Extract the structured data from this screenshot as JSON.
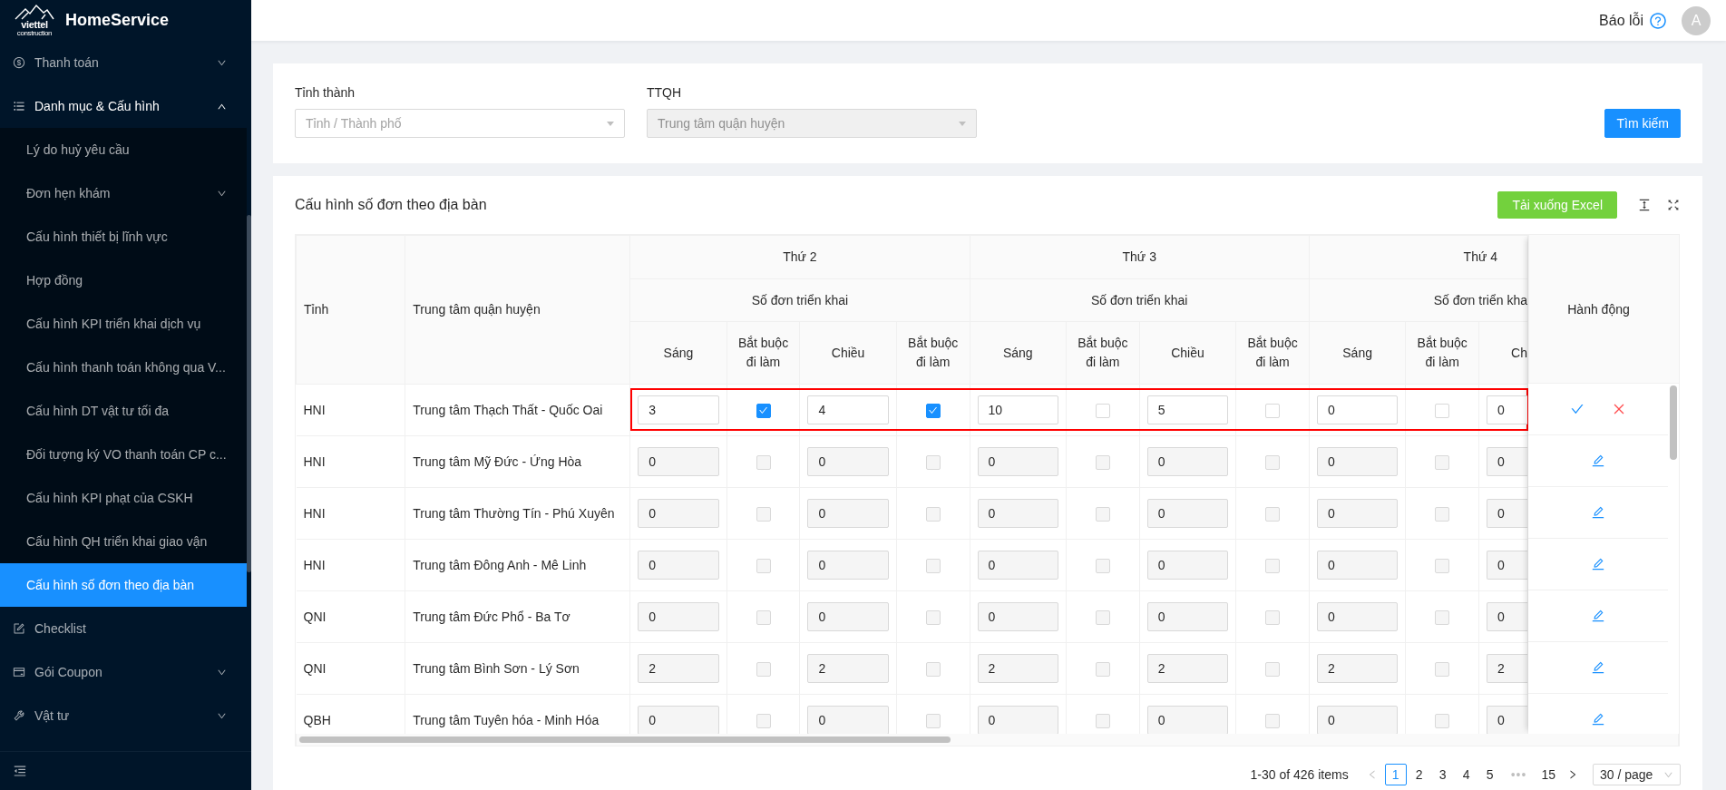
{
  "app": {
    "brand": "HomeService",
    "logo_text": "viettel",
    "logo_subtext": "construction"
  },
  "sidebar": {
    "items": [
      {
        "label": "Thanh toán",
        "kind": "dollar",
        "expanded": false
      },
      {
        "label": "Danh mục & Cấu hình",
        "kind": "list",
        "expanded": true,
        "children": [
          {
            "label": "Lý do huỷ yêu cầu",
            "selected": false
          },
          {
            "label": "Đơn hẹn khám",
            "selected": false,
            "expanded": false
          },
          {
            "label": "Cấu hình thiết bị lĩnh vực",
            "selected": false
          },
          {
            "label": "Hợp đồng",
            "selected": false
          },
          {
            "label": "Cấu hình KPI triển khai dịch vụ",
            "selected": false
          },
          {
            "label": "Cấu hình thanh toán không qua V...",
            "selected": false
          },
          {
            "label": "Cấu hình DT vật tư tối đa",
            "selected": false
          },
          {
            "label": "Đối tượng ký VO thanh toán CP c...",
            "selected": false
          },
          {
            "label": "Cấu hình KPI phạt của CSKH",
            "selected": false
          },
          {
            "label": "Cấu hình QH triển khai giao vận",
            "selected": false
          },
          {
            "label": "Cấu hình số đơn theo địa bàn",
            "selected": true
          }
        ]
      },
      {
        "label": "Checklist",
        "kind": "edit"
      },
      {
        "label": "Gói Coupon",
        "kind": "card",
        "expanded": false
      },
      {
        "label": "Vật tư",
        "kind": "tool",
        "expanded": false
      }
    ]
  },
  "header": {
    "report_label": "Báo lỗi",
    "avatar": "A"
  },
  "filters": {
    "fields": [
      {
        "label": "Tỉnh thành",
        "placeholder": "Tỉnh / Thành phố",
        "disabled": false
      },
      {
        "label": "TTQH",
        "placeholder": "Trung tâm quận huyện",
        "disabled": true
      }
    ],
    "search_button": "Tìm kiếm"
  },
  "table_card": {
    "title": "Cấu hình số đơn theo địa bàn",
    "export_button": "Tải xuống Excel",
    "columns": {
      "province": "Tỉnh",
      "center": "Trung tâm quận huyện",
      "action": "Hành động",
      "days": [
        {
          "label": "Thứ 2",
          "group": "Số đơn triển khai",
          "cut": false,
          "columns": [
            "Sáng",
            "Bắt buộc đi làm",
            "Chiều",
            "Bắt buộc đi làm"
          ]
        },
        {
          "label": "Thứ 3",
          "group": "Số đơn triển khai",
          "cut": false,
          "columns": [
            "Sáng",
            "Bắt buộc đi làm",
            "Chiều",
            "Bắt buộc đi làm"
          ]
        },
        {
          "label": "Thứ 4",
          "group": "Số đơn triển kha",
          "cut": true,
          "columns": [
            "Sáng",
            "Bắt buộc đi làm",
            "Ch"
          ]
        }
      ]
    },
    "rows": [
      {
        "province": "HNI",
        "center": "Trung tâm Thạch Thất - Quốc Oai",
        "editing": true,
        "highlighted": true,
        "cells": [
          {
            "kind": "number",
            "value": "3"
          },
          {
            "kind": "check",
            "checked": true
          },
          {
            "kind": "number",
            "value": "4"
          },
          {
            "kind": "check",
            "checked": true
          },
          {
            "kind": "number",
            "value": "10"
          },
          {
            "kind": "check",
            "checked": false
          },
          {
            "kind": "number",
            "value": "5"
          },
          {
            "kind": "check",
            "checked": false
          },
          {
            "kind": "number",
            "value": "0"
          },
          {
            "kind": "check",
            "checked": false
          },
          {
            "kind": "number",
            "value": "0"
          }
        ]
      },
      {
        "province": "HNI",
        "center": "Trung tâm Mỹ Đức - Ứng Hòa",
        "editing": false,
        "highlighted": false,
        "cells": [
          {
            "kind": "number",
            "value": "0"
          },
          {
            "kind": "check",
            "checked": false
          },
          {
            "kind": "number",
            "value": "0"
          },
          {
            "kind": "check",
            "checked": false
          },
          {
            "kind": "number",
            "value": "0"
          },
          {
            "kind": "check",
            "checked": false
          },
          {
            "kind": "number",
            "value": "0"
          },
          {
            "kind": "check",
            "checked": false
          },
          {
            "kind": "number",
            "value": "0"
          },
          {
            "kind": "check",
            "checked": false
          },
          {
            "kind": "number",
            "value": "0"
          }
        ]
      },
      {
        "province": "HNI",
        "center": "Trung tâm Thường Tín - Phú Xuyên",
        "editing": false,
        "highlighted": false,
        "cells": [
          {
            "kind": "number",
            "value": "0"
          },
          {
            "kind": "check",
            "checked": false
          },
          {
            "kind": "number",
            "value": "0"
          },
          {
            "kind": "check",
            "checked": false
          },
          {
            "kind": "number",
            "value": "0"
          },
          {
            "kind": "check",
            "checked": false
          },
          {
            "kind": "number",
            "value": "0"
          },
          {
            "kind": "check",
            "checked": false
          },
          {
            "kind": "number",
            "value": "0"
          },
          {
            "kind": "check",
            "checked": false
          },
          {
            "kind": "number",
            "value": "0"
          }
        ]
      },
      {
        "province": "HNI",
        "center": "Trung tâm Đông Anh - Mê Linh",
        "editing": false,
        "highlighted": false,
        "cells": [
          {
            "kind": "number",
            "value": "0"
          },
          {
            "kind": "check",
            "checked": false
          },
          {
            "kind": "number",
            "value": "0"
          },
          {
            "kind": "check",
            "checked": false
          },
          {
            "kind": "number",
            "value": "0"
          },
          {
            "kind": "check",
            "checked": false
          },
          {
            "kind": "number",
            "value": "0"
          },
          {
            "kind": "check",
            "checked": false
          },
          {
            "kind": "number",
            "value": "0"
          },
          {
            "kind": "check",
            "checked": false
          },
          {
            "kind": "number",
            "value": "0"
          }
        ]
      },
      {
        "province": "QNI",
        "center": "Trung tâm Đức Phổ - Ba Tơ",
        "editing": false,
        "highlighted": false,
        "cells": [
          {
            "kind": "number",
            "value": "0"
          },
          {
            "kind": "check",
            "checked": false
          },
          {
            "kind": "number",
            "value": "0"
          },
          {
            "kind": "check",
            "checked": false
          },
          {
            "kind": "number",
            "value": "0"
          },
          {
            "kind": "check",
            "checked": false
          },
          {
            "kind": "number",
            "value": "0"
          },
          {
            "kind": "check",
            "checked": false
          },
          {
            "kind": "number",
            "value": "0"
          },
          {
            "kind": "check",
            "checked": false
          },
          {
            "kind": "number",
            "value": "0"
          }
        ]
      },
      {
        "province": "QNI",
        "center": "Trung tâm Bình Sơn - Lý Sơn",
        "editing": false,
        "highlighted": false,
        "cells": [
          {
            "kind": "number",
            "value": "2"
          },
          {
            "kind": "check",
            "checked": false
          },
          {
            "kind": "number",
            "value": "2"
          },
          {
            "kind": "check",
            "checked": false
          },
          {
            "kind": "number",
            "value": "2"
          },
          {
            "kind": "check",
            "checked": false
          },
          {
            "kind": "number",
            "value": "2"
          },
          {
            "kind": "check",
            "checked": false
          },
          {
            "kind": "number",
            "value": "2"
          },
          {
            "kind": "check",
            "checked": false
          },
          {
            "kind": "number",
            "value": "2"
          }
        ]
      },
      {
        "province": "QBH",
        "center": "Trung tâm Tuyên hóa - Minh Hóa",
        "editing": false,
        "highlighted": false,
        "cells": [
          {
            "kind": "number",
            "value": "0"
          },
          {
            "kind": "check",
            "checked": false
          },
          {
            "kind": "number",
            "value": "0"
          },
          {
            "kind": "check",
            "checked": false
          },
          {
            "kind": "number",
            "value": "0"
          },
          {
            "kind": "check",
            "checked": false
          },
          {
            "kind": "number",
            "value": "0"
          },
          {
            "kind": "check",
            "checked": false
          },
          {
            "kind": "number",
            "value": "0"
          },
          {
            "kind": "check",
            "checked": false
          },
          {
            "kind": "number",
            "value": "0"
          }
        ]
      }
    ]
  },
  "pagination": {
    "summary": "1-30 of 426 items",
    "prev_disabled": true,
    "pages": [
      {
        "label": "1",
        "kind": "page",
        "selected": true
      },
      {
        "label": "2",
        "kind": "page",
        "selected": false
      },
      {
        "label": "3",
        "kind": "page",
        "selected": false
      },
      {
        "label": "4",
        "kind": "page",
        "selected": false
      },
      {
        "label": "5",
        "kind": "page",
        "selected": false
      },
      {
        "label": "•••",
        "kind": "ellipsis",
        "selected": false
      },
      {
        "label": "15",
        "kind": "page",
        "selected": false
      }
    ],
    "page_size": "30 / page"
  }
}
